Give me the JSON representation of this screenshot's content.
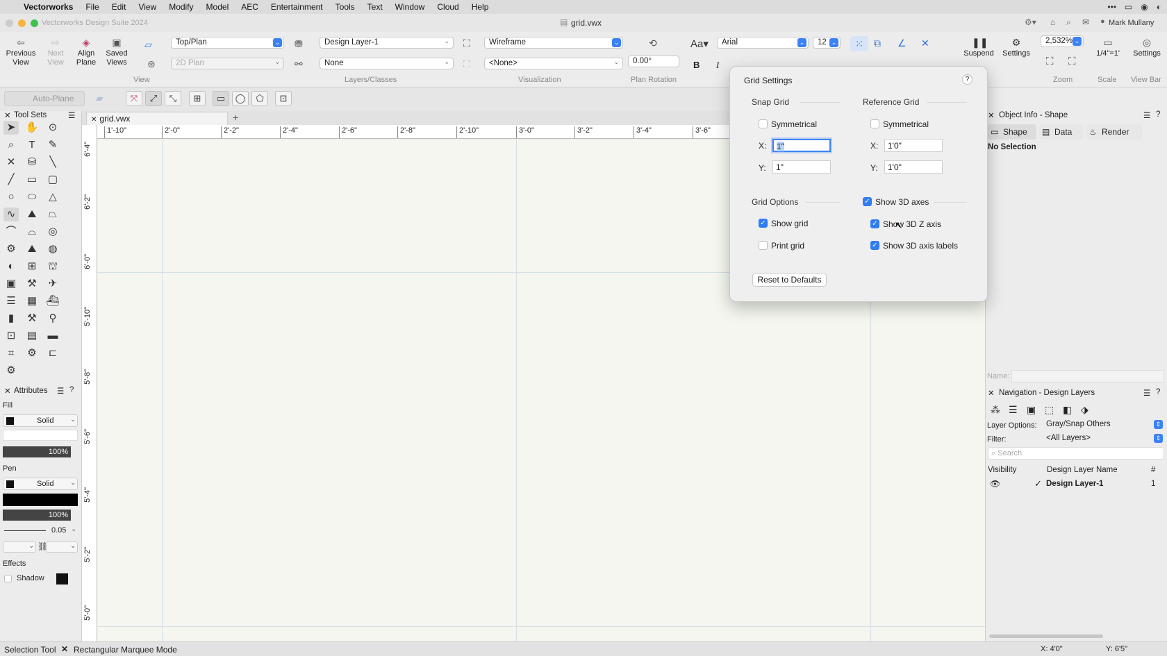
{
  "menubar": {
    "app": "Vectorworks",
    "items": [
      "File",
      "Edit",
      "View",
      "Modify",
      "Model",
      "AEC",
      "Entertainment",
      "Tools",
      "Text",
      "Window",
      "Cloud",
      "Help"
    ],
    "time_dots": "•••"
  },
  "titlebar": {
    "app_title": "Vectorworks Design Suite 2024",
    "doc_title": "grid.vwx",
    "user": "Mark Mullany"
  },
  "toolbar": {
    "previous_view": "Previous View",
    "next_view": "Next View",
    "align_plane": "Align Plane",
    "saved_views": "Saved Views",
    "view_dropdown": "Top/Plan",
    "plan_dropdown": "2D Plan",
    "layer_dropdown": "Design Layer-1",
    "class_dropdown": "None",
    "render_dropdown": "Wireframe",
    "none_dropdown": "<None>",
    "rotation_value": "0.00°",
    "font_dropdown": "Arial",
    "font_size": "12",
    "bold": "B",
    "italic": "I",
    "suspend": "Suspend",
    "settings": "Settings",
    "zoom_value": "2,532%",
    "scale_value": "1/4\"=1'",
    "settings2": "Settings",
    "groups": {
      "view": "View",
      "layers_classes": "Layers/Classes",
      "visualization": "Visualization",
      "plan_rotation": "Plan Rotation",
      "zoom": "Zoom",
      "scale": "Scale",
      "view_bar": "View Bar"
    },
    "auto_plane": "Auto-Plane"
  },
  "tool_sets": {
    "title": "Tool Sets"
  },
  "attributes": {
    "title": "Attributes",
    "fill_label": "Fill",
    "fill_style": "Solid",
    "fill_opacity": "100%",
    "pen_label": "Pen",
    "pen_style": "Solid",
    "pen_opacity": "100%",
    "line_weight": "0.05",
    "effects_label": "Effects",
    "shadow_label": "Shadow"
  },
  "document": {
    "tab": "grid.vwx",
    "add_tab": "+",
    "h_ruler": [
      "1'-10\"",
      "2'-0\"",
      "2'-2\"",
      "2'-4\"",
      "2'-6\"",
      "2'-8\"",
      "2'-10\"",
      "3'-0\"",
      "3'-2\"",
      "3'-4\"",
      "3'-6\""
    ],
    "v_ruler": [
      "6'-4\"",
      "6'-2\"",
      "6'-0\"",
      "5'-10\"",
      "5'-8\"",
      "5'-6\"",
      "5'-4\"",
      "5'-2\"",
      "5'-0\""
    ]
  },
  "grid_settings": {
    "title": "Grid Settings",
    "help": "?",
    "snap_grid": "Snap Grid",
    "reference_grid": "Reference Grid",
    "symmetrical": "Symmetrical",
    "x_label": "X:",
    "y_label": "Y:",
    "snap_x": "1\"",
    "snap_y": "1\"",
    "ref_x": "1'0\"",
    "ref_y": "1'0\"",
    "grid_options": "Grid Options",
    "show_grid": "Show grid",
    "print_grid": "Print grid",
    "show_3d_axes": "Show 3D axes",
    "show_3d_z_axis": "Show 3D Z axis",
    "show_3d_axis_labels": "Show 3D axis labels",
    "reset_defaults": "Reset to Defaults",
    "checked": {
      "snap_symmetrical": false,
      "ref_symmetrical": false,
      "show_grid": true,
      "print_grid": false,
      "show_3d_axes": true,
      "show_3d_z_axis": true,
      "show_3d_axis_labels": true
    }
  },
  "object_info": {
    "title": "Object Info - Shape",
    "tabs": [
      "Shape",
      "Data",
      "Render"
    ],
    "selection": "No Selection",
    "name_label": "Name:"
  },
  "navigation": {
    "title": "Navigation - Design Layers",
    "layer_options_label": "Layer Options:",
    "layer_options_value": "Gray/Snap Others",
    "filter_label": "Filter:",
    "filter_value": "<All Layers>",
    "search_placeholder": "Search",
    "col_visibility": "Visibility",
    "col_name": "Design Layer Name",
    "col_num": "#",
    "rows": [
      {
        "name": "Design Layer-1",
        "num": "1"
      }
    ]
  },
  "status": {
    "tool": "Selection Tool",
    "mode": "Rectangular Marquee Mode",
    "x": "X: 4'0\"",
    "y": "Y: 6'5\""
  }
}
